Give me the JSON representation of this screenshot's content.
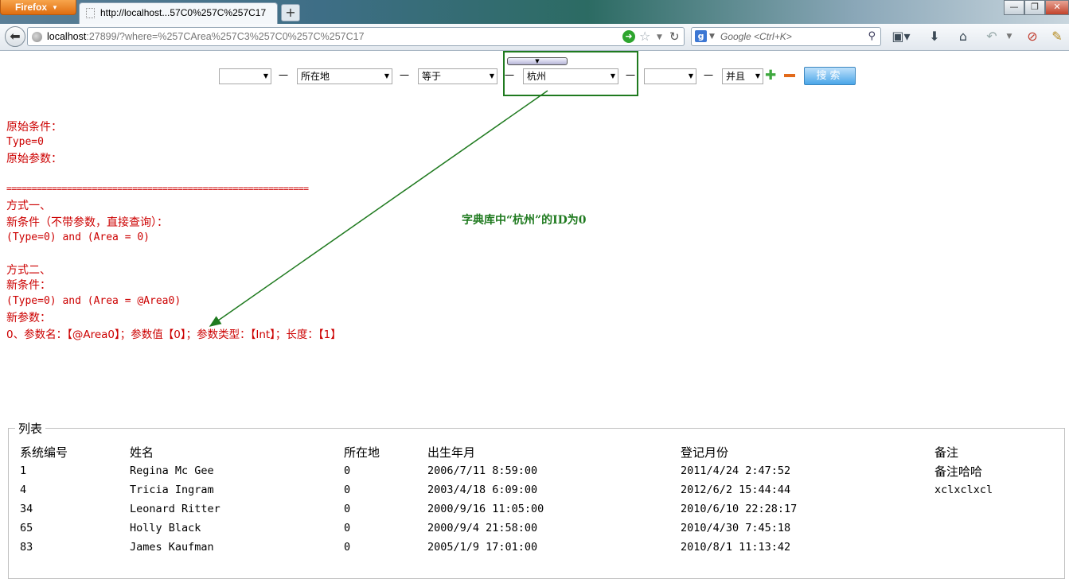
{
  "browser": {
    "menu_label": "Firefox",
    "tab_title": "http://localhost...57C0%257C%257C17",
    "new_tab": "+",
    "url_host": "localhost",
    "url_rest": ":27899/?where=%257CArea%257C3%257C0%257C%257C17",
    "search_placeholder": "Google <Ctrl+K>",
    "search_engine": "g"
  },
  "filter": {
    "field_select": "所在地",
    "operator_select": "等于",
    "value_select": "杭州",
    "logic_select": "并且",
    "separator": "一",
    "search_button": "搜索"
  },
  "output": {
    "orig_cond_label": "原始条件：",
    "orig_cond_value": "Type=0",
    "orig_params_label": "原始参数：",
    "divider": "============================================================",
    "method1_title": "方式一、",
    "method1_label": "新条件（不带参数，直接查询）：",
    "method1_value": "(Type=0) and (Area = 0)",
    "method2_title": "方式二、",
    "method2_cond_label": "新条件：",
    "method2_cond_value": "(Type=0) and (Area = @Area0)",
    "method2_params_label": "新参数：",
    "method2_params_value": "0、参数名：【@Area0】；参数值【0】；参数类型：【Int】；长度：【1】"
  },
  "annotation": {
    "note": "字典库中“杭州”的ID为0",
    "color": "#1f7a1f"
  },
  "list": {
    "legend": "列表",
    "headers": [
      "系统编号",
      "姓名",
      "所在地",
      "出生年月",
      "登记月份",
      "备注"
    ],
    "rows": [
      [
        "1",
        "Regina Mc Gee",
        "0",
        "2006/7/11 8:59:00",
        "2011/4/24 2:47:52",
        "备注哈哈"
      ],
      [
        "4",
        "Tricia Ingram",
        "0",
        "2003/4/18 6:09:00",
        "2012/6/2 15:44:44",
        "xclxclxcl"
      ],
      [
        "34",
        "Leonard Ritter",
        "0",
        "2000/9/16 11:05:00",
        "2010/6/10 22:28:17",
        ""
      ],
      [
        "65",
        "Holly Black",
        "0",
        "2000/9/4 21:58:00",
        "2010/4/30 7:45:18",
        ""
      ],
      [
        "83",
        "James Kaufman",
        "0",
        "2005/1/9 17:01:00",
        "2010/8/1 11:13:42",
        ""
      ]
    ]
  }
}
